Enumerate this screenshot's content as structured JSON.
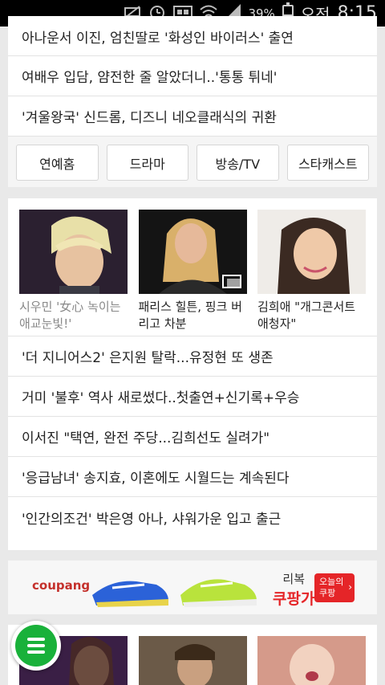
{
  "status_bar": {
    "battery_percent": "39%",
    "ampm": "오전",
    "time": "8:15"
  },
  "top_news": [
    "아나운서 이진, 엄친딸로 '화성인 바이러스' 출연",
    "여배우 입담, 얌전한 줄 알았더니..'통통 튀네'",
    "'겨울왕국' 신드롬, 디즈니 네오클래식의 귀환"
  ],
  "categories": [
    "연예홈",
    "드라마",
    "방송/TV",
    "스타캐스트"
  ],
  "photo_news": [
    {
      "caption": "시우민 '女心 녹이는 애교눈빛!'"
    },
    {
      "caption": "패리스 힐튼, 핑크 버리고 차분"
    },
    {
      "caption": "김희애 \"개그콘서트 애청자\""
    }
  ],
  "news_list": [
    "'더 지니어스2' 은지원 탈락...유정현 또 생존",
    "거미 '불후' 역사 새로썼다..첫출연+신기록+우승",
    "이서진 \"택연, 완전 주당...김희선도 실려가\"",
    "'응급남녀' 송지효, 이혼에도 시월드는 계속된다",
    "'인간의조건' 박은영 아나, 샤워가운 입고 출근"
  ],
  "ad": {
    "brand": "coupang",
    "product_label": "리복",
    "product_sub": "쿠팡가",
    "badge_line1": "오늘의",
    "badge_line2": "쿠팡"
  },
  "colors": {
    "accent_green": "#19b13a",
    "coupang_red": "#e52528"
  }
}
